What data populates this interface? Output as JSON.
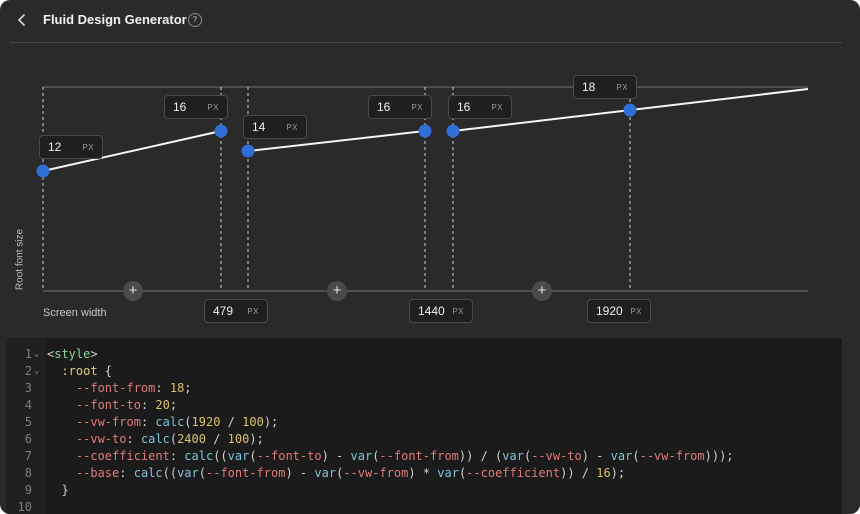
{
  "header": {
    "title": "Fluid Design Generator",
    "help_glyph": "?"
  },
  "chart": {
    "y_axis_label": "Root font size",
    "x_axis_label": "Screen width",
    "unit": "PX",
    "breakpoints": [
      {
        "value": "479",
        "unit": "PX"
      },
      {
        "value": "1440",
        "unit": "PX"
      },
      {
        "value": "1920",
        "unit": "PX"
      }
    ],
    "segments": [
      {
        "from": "12",
        "to": "16"
      },
      {
        "from": "14",
        "to": "16"
      },
      {
        "from": "16",
        "to": "18"
      }
    ],
    "colors": {
      "point": "#2f6fd6",
      "line": "#f5f5f5"
    }
  },
  "code": {
    "lines": [
      {
        "n": "1",
        "fold": true,
        "text": "<style>"
      },
      {
        "n": "2",
        "fold": true,
        "text": "  :root {"
      },
      {
        "n": "3",
        "fold": false,
        "text": "    --font-from: 18;"
      },
      {
        "n": "4",
        "fold": false,
        "text": "    --font-to: 20;"
      },
      {
        "n": "5",
        "fold": false,
        "text": "    --vw-from: calc(1920 / 100);"
      },
      {
        "n": "6",
        "fold": false,
        "text": "    --vw-to: calc(2400 / 100);"
      },
      {
        "n": "7",
        "fold": false,
        "text": "    --coefficient: calc((var(--font-to) - var(--font-from)) / (var(--vw-to) - var(--vw-from)));"
      },
      {
        "n": "8",
        "fold": false,
        "text": "    --base: calc((var(--font-from) - var(--vw-from) * var(--coefficient)) / 16);"
      },
      {
        "n": "9",
        "fold": false,
        "text": "  }"
      },
      {
        "n": "10",
        "fold": false,
        "text": ""
      }
    ]
  }
}
